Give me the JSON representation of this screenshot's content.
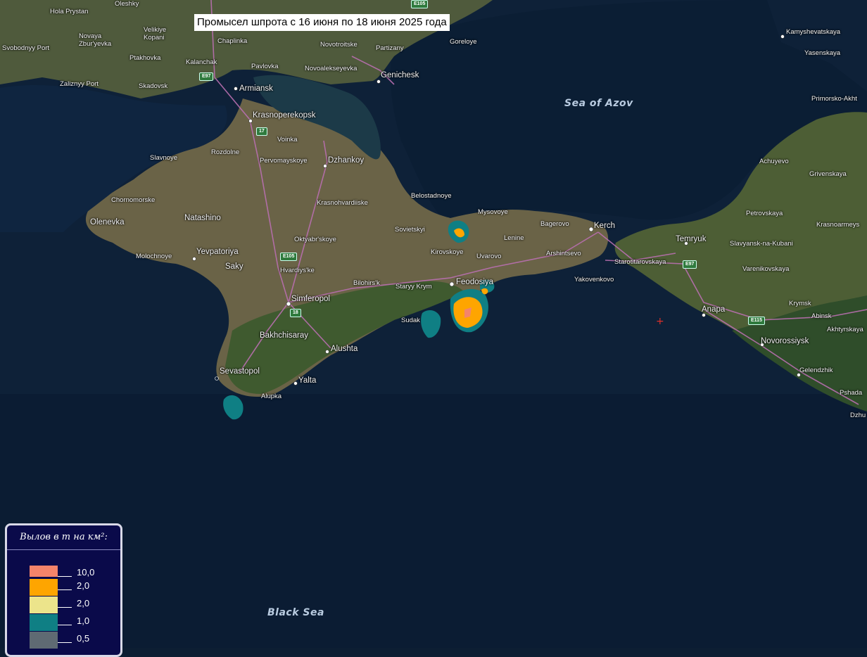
{
  "title": "Промысел шпрота с 16 июня по 18 июня 2025 года",
  "legend": {
    "title": "Вылов в т на км²:",
    "items": [
      {
        "label": "10,0",
        "color": "#f4846a"
      },
      {
        "label": "2,0",
        "color": "#fea500"
      },
      {
        "label": "2,0",
        "color": "#ece48b"
      },
      {
        "label": "1,0",
        "color": "#0f7f84"
      },
      {
        "label": "0,5",
        "color": "#5f6a73"
      }
    ]
  },
  "seas": {
    "azov": "Sea of Azov",
    "black": "Black Sea"
  },
  "places": [
    "Oleshky",
    "Hola Prystan",
    "Velikiye Kopani",
    "Novaya Zbur'yevka",
    "Svobodnyy Port",
    "Ptakhovka",
    "Kalanchak",
    "Chaplinka",
    "Novotroitske",
    "Partizany",
    "Goreloye",
    "Pavlovka",
    "Novoalekseyevka",
    "Genichesk",
    "Zaliznyy Port",
    "Skadovsk",
    "Armiansk",
    "Krasnoperekopsk",
    "Voinka",
    "Slavnoye",
    "Rozdolne",
    "Pervomayskoye",
    "Dzhankoy",
    "Chornomorske",
    "Olenevka",
    "Natashino",
    "Krasnohvardiiske",
    "Belostadnoye",
    "Sovietskyi",
    "Mysovoye",
    "Bagerovo",
    "Kerch",
    "Lenine",
    "Oktyabr'skoye",
    "Molochnoye",
    "Yevpatoriya",
    "Saky",
    "Kirovskoye",
    "Uvarovo",
    "Arshintsevo",
    "Hvardiys'ke",
    "Bilohirs'k",
    "Staryy Krym",
    "Feodosiya",
    "Yakovenkovo",
    "Simferopol",
    "Sudak",
    "Bakhchisaray",
    "Alushta",
    "Sevastopol",
    "Yalta",
    "Alupka",
    "Kamyshevatskaya",
    "Yasenskaya",
    "Primorsko-Akht",
    "Achuyevo",
    "Grivenskaya",
    "Petrovskaya",
    "Krasnoarmeys",
    "Temryuk",
    "Slavyansk-na-Kubani",
    "Varenikovskaya",
    "Starotitarovskaya",
    "Anapa",
    "Krymsk",
    "Abinsk",
    "Akhtyrskaya",
    "Novorossiysk",
    "Gelendzhik",
    "Pshada",
    "Dzhu"
  ],
  "roads": [
    "E105",
    "E97",
    "17",
    "E105",
    "18",
    "E97",
    "E115",
    "E105"
  ]
}
